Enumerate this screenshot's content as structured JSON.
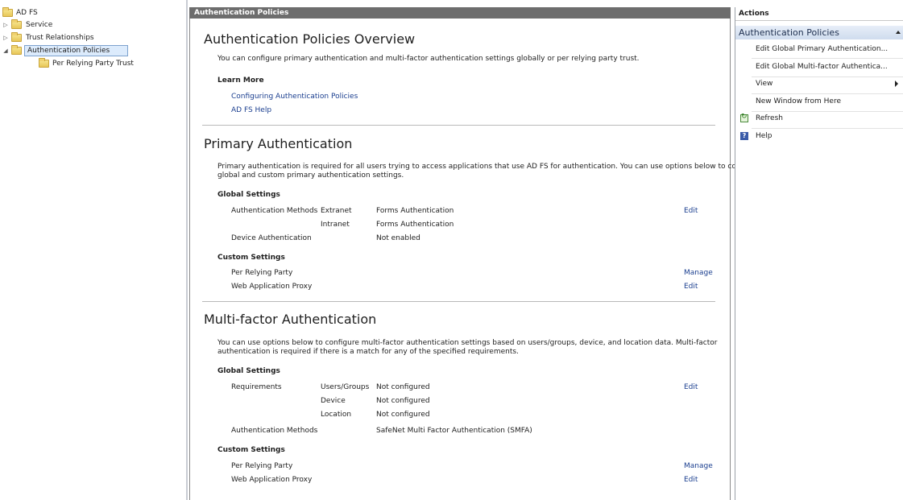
{
  "tree": {
    "root": "AD FS",
    "items": [
      {
        "label": "Service"
      },
      {
        "label": "Trust Relationships"
      },
      {
        "label": "Authentication Policies"
      },
      {
        "label": "Per Relying Party Trust"
      }
    ]
  },
  "center": {
    "header": "Authentication Policies",
    "overview": {
      "title": "Authentication Policies Overview",
      "description": "You can configure primary authentication and multi-factor authentication settings globally or per relying party trust.",
      "learn_more": "Learn More",
      "link1": "Configuring Authentication Policies",
      "link2": "AD FS Help"
    },
    "primary": {
      "title": "Primary Authentication",
      "description_line1": "Primary authentication is required for all users trying to access applications that use AD FS for authentication. You can use options below to configure",
      "description_line2": "global and custom primary authentication settings.",
      "global_settings": "Global Settings",
      "auth_methods_label": "Authentication Methods",
      "extranet_label": "Extranet",
      "extranet_value": "Forms Authentication",
      "intranet_label": "Intranet",
      "intranet_value": "Forms Authentication",
      "device_auth_label": "Device Authentication",
      "device_auth_value": "Not enabled",
      "edit": "Edit",
      "custom_settings": "Custom Settings",
      "per_rp_label": "Per Relying Party",
      "manage": "Manage",
      "wap_label": "Web Application Proxy",
      "wap_edit": "Edit"
    },
    "mfa": {
      "title": "Multi-factor Authentication",
      "description_line1": "You can use options below to configure multi-factor authentication settings based on users/groups, device, and location data. Multi-factor",
      "description_line2": "authentication is required if there is a match for any of the specified requirements.",
      "global_settings": "Global Settings",
      "requirements_label": "Requirements",
      "users_groups_label": "Users/Groups",
      "users_groups_value": "Not configured",
      "device_label": "Device",
      "device_value": "Not configured",
      "location_label": "Location",
      "location_value": "Not configured",
      "edit": "Edit",
      "auth_methods_label": "Authentication Methods",
      "auth_methods_value": "SafeNet Multi Factor Authentication (SMFA)",
      "custom_settings": "Custom Settings",
      "per_rp_label": "Per Relying Party",
      "manage": "Manage",
      "wap_label": "Web Application Proxy",
      "wap_edit": "Edit"
    }
  },
  "actions": {
    "title": "Actions",
    "section": "Authentication Policies",
    "items": [
      {
        "label": "Edit Global Primary Authentication..."
      },
      {
        "label": "Edit Global Multi-factor Authentica..."
      },
      {
        "label": "View"
      },
      {
        "label": "New Window from Here"
      },
      {
        "label": "Refresh"
      },
      {
        "label": "Help"
      }
    ]
  },
  "icons": {
    "folder": "folder-icon",
    "expand": "expand-arrow-icon",
    "collapse": "collapse-arrow-icon",
    "refresh": "refresh-icon",
    "help": "help-icon"
  },
  "colors": {
    "header_bg": "#6d6d6d",
    "link": "#1a3e8f",
    "selection": "#dcebfc",
    "actions_section": "#cfdcee"
  }
}
